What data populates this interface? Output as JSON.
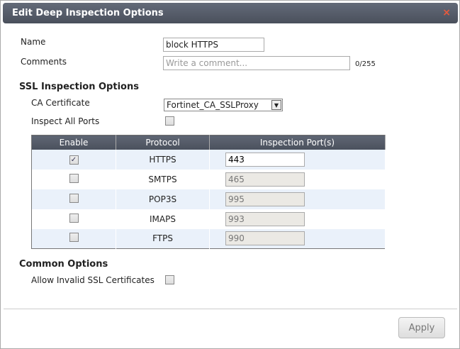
{
  "dialog": {
    "title": "Edit Deep Inspection Options",
    "close_icon": "×"
  },
  "name": {
    "label": "Name",
    "value": "block HTTPS"
  },
  "comments": {
    "label": "Comments",
    "placeholder": "Write a comment...",
    "counter": "0/255"
  },
  "ssl": {
    "heading": "SSL Inspection Options",
    "ca_label": "CA Certificate",
    "ca_value": "Fortinet_CA_SSLProxy",
    "inspect_all_label": "Inspect All Ports",
    "inspect_all_checked": false
  },
  "table": {
    "headers": [
      "Enable",
      "Protocol",
      "Inspection Port(s)"
    ],
    "rows": [
      {
        "enabled": true,
        "protocol": "HTTPS",
        "port": "443"
      },
      {
        "enabled": false,
        "protocol": "SMTPS",
        "port": "465"
      },
      {
        "enabled": false,
        "protocol": "POP3S",
        "port": "995"
      },
      {
        "enabled": false,
        "protocol": "IMAPS",
        "port": "993"
      },
      {
        "enabled": false,
        "protocol": "FTPS",
        "port": "990"
      }
    ]
  },
  "common": {
    "heading": "Common Options",
    "allow_invalid_label": "Allow Invalid SSL Certificates",
    "allow_invalid_checked": false
  },
  "footer": {
    "apply_label": "Apply"
  }
}
